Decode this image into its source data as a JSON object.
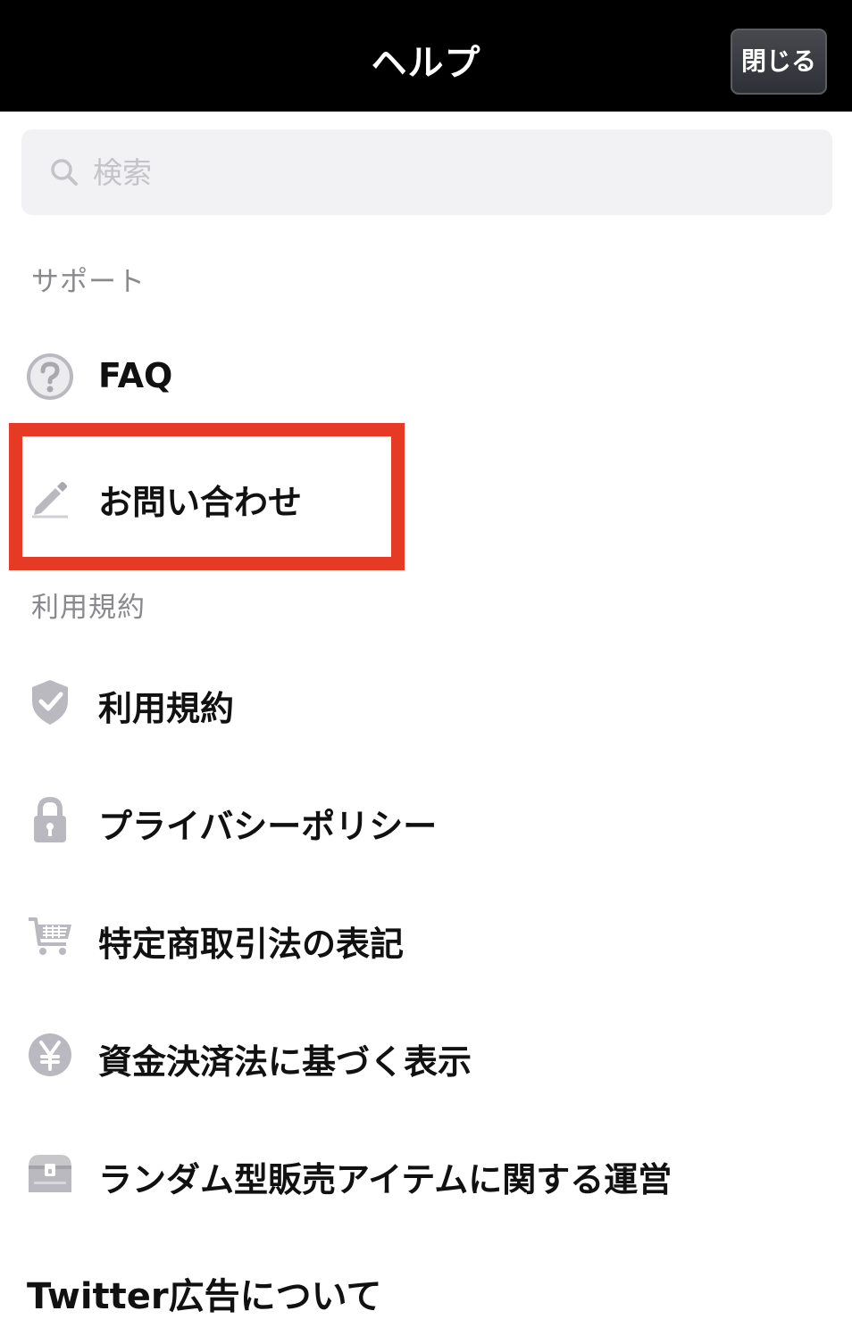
{
  "header": {
    "title": "ヘルプ",
    "close_label": "閉じる"
  },
  "search": {
    "placeholder": "検索",
    "value": ""
  },
  "sections": {
    "support": {
      "label": "サポート",
      "items": [
        {
          "label": "FAQ",
          "icon": "question-icon"
        },
        {
          "label": "お問い合わせ",
          "icon": "pencil-icon"
        }
      ]
    },
    "terms": {
      "label": "利用規約",
      "items": [
        {
          "label": "利用規約",
          "icon": "shield-check-icon"
        },
        {
          "label": "プライバシーポリシー",
          "icon": "lock-icon"
        },
        {
          "label": "特定商取引法の表記",
          "icon": "cart-icon"
        },
        {
          "label": "資金決済法に基づく表示",
          "icon": "yen-icon"
        },
        {
          "label": "ランダム型販売アイテムに関する運営",
          "icon": "treasure-chest-icon"
        }
      ]
    },
    "twitter_ads": {
      "label": "Twitter広告について"
    }
  },
  "colors": {
    "header_bg": "#000000",
    "highlight": "#e63a25",
    "icon_gray": "#b9b9bf",
    "section_text": "#8a8a8e"
  }
}
